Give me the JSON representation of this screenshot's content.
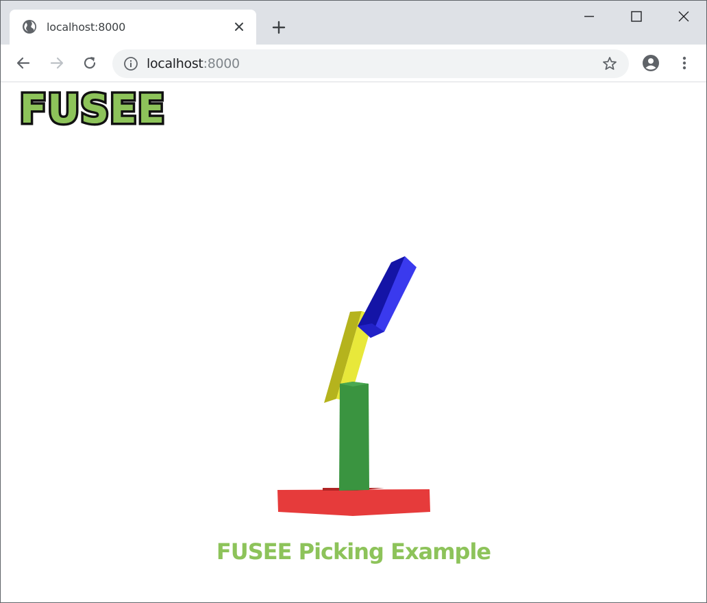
{
  "browser": {
    "tab": {
      "title": "localhost:8000",
      "favicon": "globe-icon",
      "close_icon": "close-icon"
    },
    "new_tab_icon": "plus-icon",
    "window_controls": [
      "minimize-icon",
      "maximize-icon",
      "close-icon"
    ],
    "toolbar": {
      "back_icon": "arrow-left-icon",
      "forward_icon": "arrow-right-icon",
      "reload_icon": "reload-icon",
      "site_info_icon": "info-icon",
      "url_host": "localhost",
      "url_port": ":8000",
      "bookmark_icon": "star-icon",
      "profile_icon": "account-icon",
      "menu_icon": "kebab-menu-icon"
    }
  },
  "page": {
    "logo_text": "FUSEE",
    "caption": "FUSEE Picking Example",
    "scene": {
      "objects": [
        "base",
        "lower-arm",
        "middle-arm",
        "upper-arm"
      ],
      "colors": {
        "base": "#e63b3b",
        "lower_arm": "#3a9440",
        "middle_arm": "#e8e83a",
        "upper_arm": "#3a3aee",
        "brand_green": "#8dc35a"
      }
    }
  }
}
